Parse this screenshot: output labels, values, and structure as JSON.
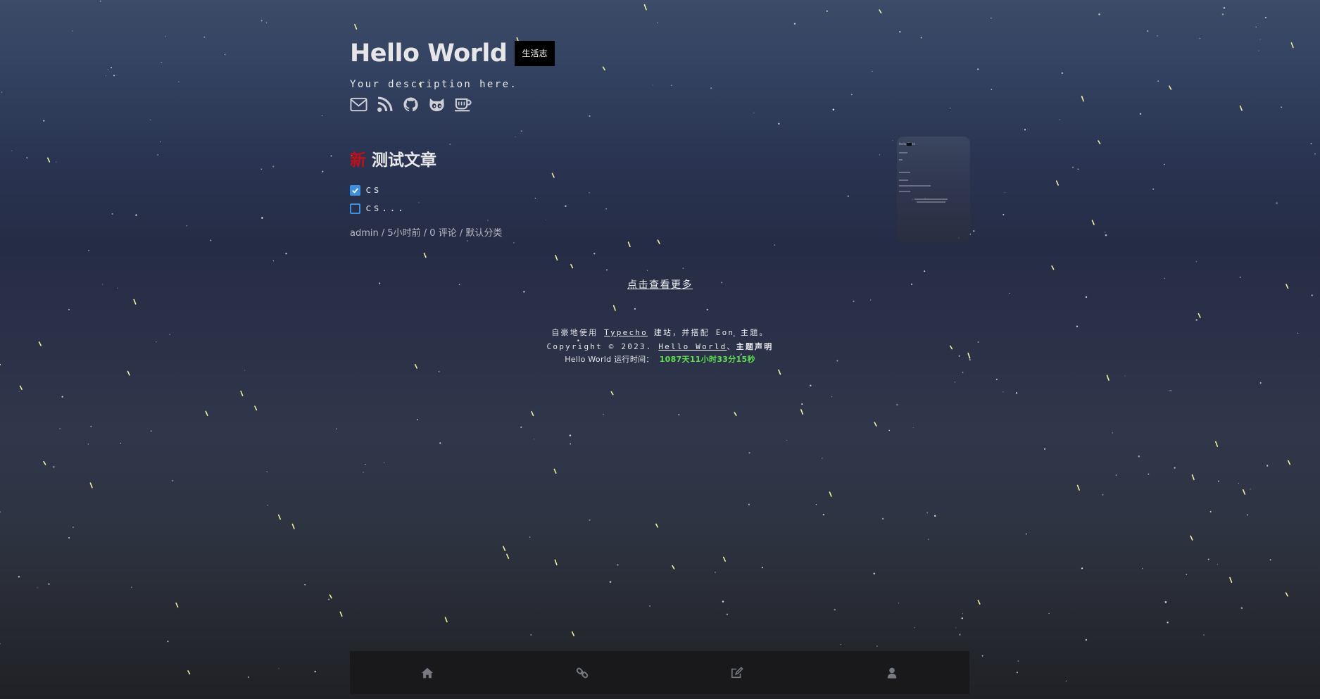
{
  "site": {
    "title": "Hello World",
    "badge": "生活志",
    "description": "Your description here."
  },
  "social": [
    {
      "icon": "mail-icon"
    },
    {
      "icon": "rss-icon"
    },
    {
      "icon": "github-icon"
    },
    {
      "icon": "cat-icon"
    },
    {
      "icon": "coffee-icon"
    }
  ],
  "post": {
    "new_tag": "新",
    "title": "测试文章",
    "tasks": [
      {
        "label": "cs",
        "checked": true
      },
      {
        "label": "cs...",
        "checked": false
      }
    ],
    "meta": "admin / 5小时前 / 0 评论 / 默认分类"
  },
  "view_more": "点击查看更多",
  "footer": {
    "line1_prefix": "自豪地使用",
    "line1_link": "Typecho",
    "line1_suffix": "建站，并搭配 Eon 主题。",
    "line2_prefix": "Copyright © 2023.",
    "line2_link": "Hello World",
    "line2_sep": "、",
    "line2_bold": "主题声明",
    "runtime_label": "Hello World 运行时间：",
    "runtime_value": "1087天11小时33分15秒"
  },
  "bottom_nav": [
    {
      "icon": "home-icon"
    },
    {
      "icon": "link-icon"
    },
    {
      "icon": "edit-icon"
    },
    {
      "icon": "user-icon"
    }
  ],
  "colors": {
    "new_tag": "#c10f1a",
    "checkbox": "#3d8fe0",
    "runtime": "#5fe050",
    "nav_bg": "#19191b"
  }
}
